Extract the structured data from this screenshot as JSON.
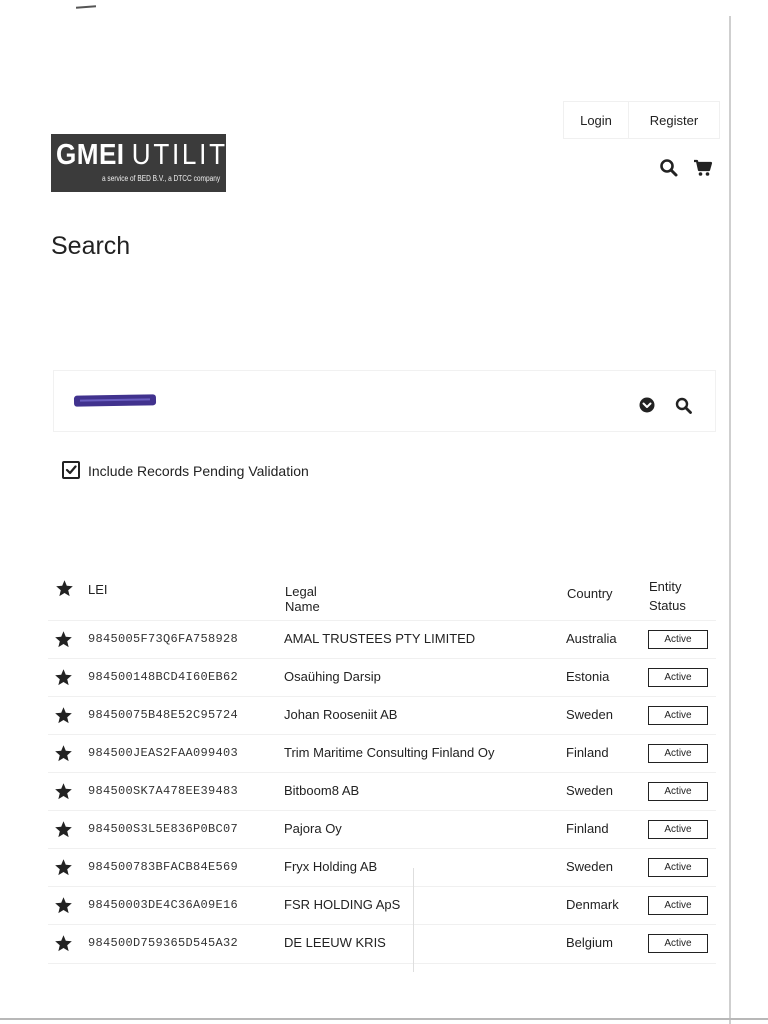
{
  "header": {
    "nav": {
      "login_label": "Login",
      "register_label": "Register"
    },
    "logo": {
      "main_bold": "GMEI",
      "main_light": "UTILITY",
      "sub": "a service of BED B.V., a DTCC company"
    },
    "icons": [
      "search-icon",
      "cart-icon"
    ]
  },
  "page": {
    "title": "Search"
  },
  "search": {
    "query_redacted": true,
    "icons": [
      "chevron-down-circle-icon",
      "search-icon"
    ]
  },
  "filters": {
    "include_pending_label": "Include Records Pending Validation",
    "include_pending_checked": true
  },
  "table": {
    "headers": {
      "lei": "LEI",
      "legal_name": "Legal Name",
      "country": "Country",
      "status_line1": "Entity",
      "status_line2": "Status"
    },
    "rows": [
      {
        "lei": "9845005F73Q6FA758928",
        "name": "AMAL TRUSTEES PTY LIMITED",
        "country": "Australia",
        "status": "Active"
      },
      {
        "lei": "984500148BCD4I60EB62",
        "name": "Osaühing Darsip",
        "country": "Estonia",
        "status": "Active"
      },
      {
        "lei": "98450075B48E52C95724",
        "name": "Johan Rooseniit AB",
        "country": "Sweden",
        "status": "Active"
      },
      {
        "lei": "984500JEAS2FAA099403",
        "name": "Trim Maritime Consulting Finland Oy",
        "country": "Finland",
        "status": "Active"
      },
      {
        "lei": "984500SK7A478EE39483",
        "name": "Bitboom8 AB",
        "country": "Sweden",
        "status": "Active"
      },
      {
        "lei": "984500S3L5E836P0BC07",
        "name": "Pajora Oy",
        "country": "Finland",
        "status": "Active"
      },
      {
        "lei": "984500783BFACB84E569",
        "name": "Fryx Holding AB",
        "country": "Sweden",
        "status": "Active"
      },
      {
        "lei": "98450003DE4C36A09E16",
        "name": "FSR HOLDING ApS",
        "country": "Denmark",
        "status": "Active"
      },
      {
        "lei": "984500D759365D545A32",
        "name": "DE LEEUW KRIS",
        "country": "Belgium",
        "status": "Active"
      }
    ]
  },
  "colors": {
    "logo_bg": "#3b3b3b",
    "text": "#222222",
    "redaction": "#41328e"
  }
}
